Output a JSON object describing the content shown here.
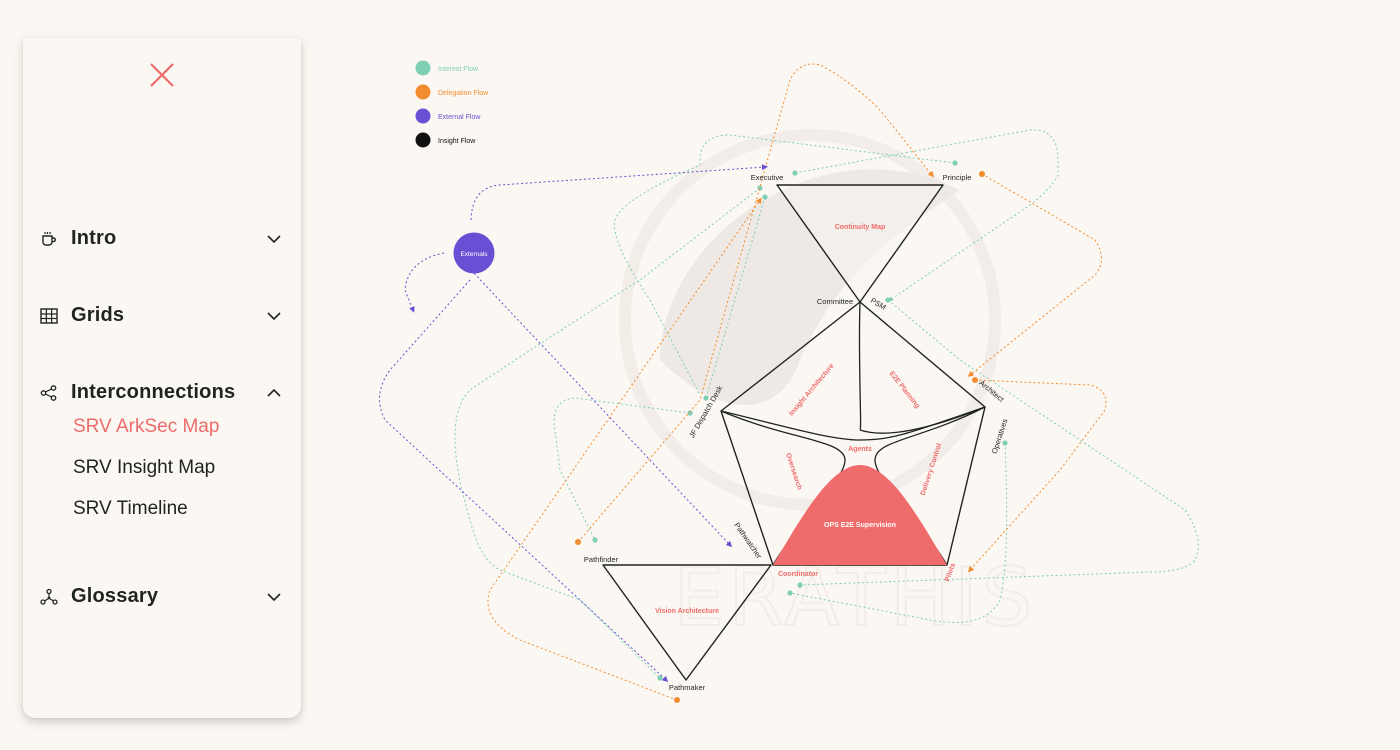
{
  "sidebar": {
    "sections": [
      {
        "label": "Intro",
        "icon": "coffee-cup-icon",
        "expanded": false
      },
      {
        "label": "Grids",
        "icon": "grid-table-icon",
        "expanded": false
      },
      {
        "label": "Interconnections",
        "icon": "share-nodes-icon",
        "expanded": true,
        "items": [
          {
            "label": "SRV ArkSec Map",
            "active": true
          },
          {
            "label": "SRV Insight Map",
            "active": false
          },
          {
            "label": "SRV Timeline",
            "active": false
          }
        ]
      },
      {
        "label": "Glossary",
        "icon": "network-nodes-icon",
        "expanded": false
      }
    ]
  },
  "legend": [
    {
      "label": "Interest Flow",
      "color": "#7ecfb4"
    },
    {
      "label": "Delegation Flow",
      "color": "#f28c2e"
    },
    {
      "label": "External Flow",
      "color": "#6a4fd4"
    },
    {
      "label": "Insight Flow",
      "color": "#111111"
    }
  ],
  "colors": {
    "accent": "#ef6b6b",
    "interest": "#7ecfb4",
    "delegation": "#f28c2e",
    "external": "#6a4fd4",
    "background": "#fbf7f2"
  },
  "diagram": {
    "nodes": {
      "executive": "Executive",
      "principle": "Principle",
      "committee": "Committee",
      "psm": "PSM",
      "architect": "Architect",
      "operatives": "Operatives",
      "jf_dispatch": "JF Dispatch Desk",
      "pathwatcher": "Pathwatcher",
      "pathfinder": "Pathfinder",
      "pathmaker": "Pathmaker",
      "coordinator": "Coordinator",
      "pilots": "Pilots",
      "externals": "Externals"
    },
    "areas": {
      "continuity_map": "Continuity Map",
      "insight_architecture": "Insight Architecture",
      "e2e_planning": "E2E Planning",
      "agents": "Agents",
      "oversearch": "Oversearch",
      "delivery_control": "Delivery Control",
      "ops_supervision": "OPS E2E Supervision",
      "vision_architecture": "Vision Architecture"
    },
    "watermark": "ERATHIS"
  }
}
